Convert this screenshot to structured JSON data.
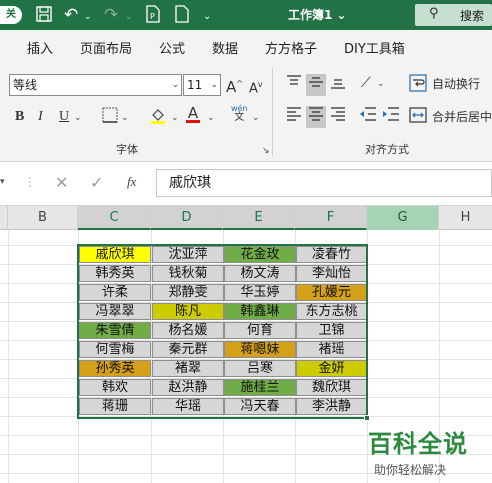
{
  "titlebar": {
    "close_label": "关",
    "workbook_title": "工作簿1",
    "title_arrow": "⌄",
    "search_label": "搜索",
    "colors": {
      "bar": "#217346"
    }
  },
  "menu": [
    "插入",
    "页面布局",
    "公式",
    "数据",
    "方方格子",
    "DIY工具箱"
  ],
  "ribbon": {
    "font_name": "等线",
    "font_size": "11",
    "font_group_label": "字体",
    "align_group_label": "对齐方式",
    "wrap_text_label": "自动换行",
    "merge_center_label": "合并后居中",
    "bold": "B",
    "italic": "I",
    "underline": "U",
    "grow_font": "A",
    "shrink_font": "A",
    "font_color_letter": "A",
    "wen": "wén",
    "wen_char": "文"
  },
  "formula_bar": {
    "fx": "fx",
    "value": "戚欣琪"
  },
  "columns": [
    {
      "label": "B",
      "selected": false
    },
    {
      "label": "C",
      "selected": true
    },
    {
      "label": "D",
      "selected": true
    },
    {
      "label": "E",
      "selected": true
    },
    {
      "label": "F",
      "selected": true
    },
    {
      "label": "G",
      "selected": false
    },
    {
      "label": "H",
      "selected": false
    }
  ],
  "colors": {
    "yellow": "#ffff00",
    "green": "#70ad47",
    "gold": "#d4a017",
    "lime": "#cccc00",
    "gray": "#d6d6d6",
    "selection": "#217346"
  },
  "table": [
    [
      {
        "t": "戚欣琪",
        "c": "yellow"
      },
      {
        "t": "沈亚萍",
        "c": "gray"
      },
      {
        "t": "花金玫",
        "c": "green"
      },
      {
        "t": "凌春竹",
        "c": "gray"
      }
    ],
    [
      {
        "t": "韩秀英",
        "c": "gray"
      },
      {
        "t": "钱秋菊",
        "c": "gray"
      },
      {
        "t": "杨文涛",
        "c": "gray"
      },
      {
        "t": "李灿怡",
        "c": "gray"
      }
    ],
    [
      {
        "t": "许柔",
        "c": "gray"
      },
      {
        "t": "郑静雯",
        "c": "gray"
      },
      {
        "t": "华玉婷",
        "c": "gray"
      },
      {
        "t": "孔媛元",
        "c": "gold"
      }
    ],
    [
      {
        "t": "冯翠翠",
        "c": "gray"
      },
      {
        "t": "陈凡",
        "c": "lime"
      },
      {
        "t": "韩鑫琳",
        "c": "green"
      },
      {
        "t": "东方志桃",
        "c": "gray"
      }
    ],
    [
      {
        "t": "朱雪倩",
        "c": "green"
      },
      {
        "t": "杨名媛",
        "c": "gray"
      },
      {
        "t": "何育",
        "c": "gray"
      },
      {
        "t": "卫锦",
        "c": "gray"
      }
    ],
    [
      {
        "t": "何雪梅",
        "c": "gray"
      },
      {
        "t": "秦元群",
        "c": "gray"
      },
      {
        "t": "蒋嗯妹",
        "c": "gold"
      },
      {
        "t": "褚瑶",
        "c": "gray"
      }
    ],
    [
      {
        "t": "孙秀英",
        "c": "gold"
      },
      {
        "t": "褚翠",
        "c": "gray"
      },
      {
        "t": "吕寒",
        "c": "gray"
      },
      {
        "t": "金妍",
        "c": "lime"
      }
    ],
    [
      {
        "t": "韩欢",
        "c": "gray"
      },
      {
        "t": "赵洪静",
        "c": "gray"
      },
      {
        "t": "施桂兰",
        "c": "green"
      },
      {
        "t": "魏欣琪",
        "c": "gray"
      }
    ],
    [
      {
        "t": "蒋珊",
        "c": "gray"
      },
      {
        "t": "华瑶",
        "c": "gray"
      },
      {
        "t": "冯天春",
        "c": "gray"
      },
      {
        "t": "李洪静",
        "c": "gray"
      }
    ]
  ],
  "watermark": {
    "big": "百科全说",
    "small": "助你轻松解决"
  }
}
